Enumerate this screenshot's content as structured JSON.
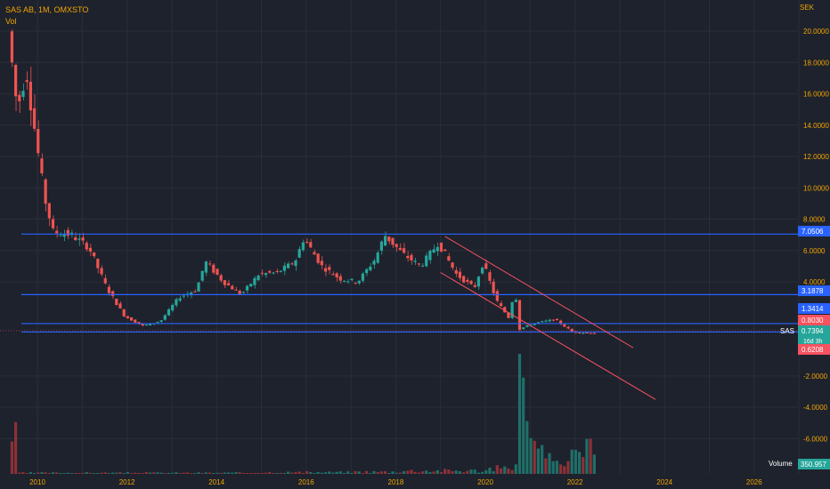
{
  "legend": {
    "symbol": "SAS AB, 1M, OMXSTO",
    "indicator": "Vol"
  },
  "axis": {
    "currency": "SEK",
    "price_ticks": [
      "20.0000",
      "18.0000",
      "16.0000",
      "14.0000",
      "12.0000",
      "10.0000",
      "8.0000",
      "6.0000",
      "4.0000",
      "-2.0000",
      "-4.0000",
      "-6.0000"
    ],
    "price_values": [
      20,
      18,
      16,
      14,
      12,
      10,
      8,
      6,
      4,
      -2,
      -4,
      -6
    ],
    "time_ticks": [
      "2010",
      "2012",
      "2014",
      "2016",
      "2018",
      "2020",
      "2022",
      "2024",
      "2026"
    ],
    "time_values": [
      2010,
      2012,
      2014,
      2016,
      2018,
      2020,
      2022,
      2024,
      2026
    ]
  },
  "levels": [
    {
      "label": "7.0506",
      "value": 7.0506,
      "color": "#2962ff"
    },
    {
      "label": "3.1878",
      "value": 3.1878,
      "color": "#2962ff"
    },
    {
      "label": "1.3414",
      "value": 1.3414,
      "color": "#2962ff"
    },
    {
      "label": "0.8030",
      "value": 0.803,
      "color": "#f23645"
    }
  ],
  "badges": {
    "symbol_label": "SAS",
    "last_price": "0.7394",
    "countdown": "16d 3h",
    "low_price": "0.6208",
    "volume_label": "Volume",
    "volume_value": "350.957"
  },
  "colors": {
    "up": "#26a69a",
    "down": "#ef5350",
    "line": "#2962ff",
    "channel": "#f7525f",
    "bg": "#1e222d",
    "axis_text": "#f0a500"
  },
  "chart_data": {
    "type": "candlestick",
    "title": "SAS AB, 1M, OMXSTO",
    "ylabel": "SEK",
    "ylim": [
      -6.5,
      21
    ],
    "xlim": [
      2009.3,
      2027.6
    ],
    "grid": true,
    "horizontal_levels": [
      7.0506,
      3.1878,
      1.3414,
      0.803
    ],
    "channel": {
      "upper": {
        "from": [
          2019.1,
          6.9
        ],
        "to": [
          2023.3,
          -0.2
        ]
      },
      "lower": {
        "from": [
          2019.0,
          4.6
        ],
        "to": [
          2023.8,
          -3.5
        ]
      }
    },
    "price_path": [
      [
        2009.4,
        20.0
      ],
      [
        2009.6,
        15.0
      ],
      [
        2009.8,
        17.5
      ],
      [
        2010.0,
        13.5
      ],
      [
        2010.2,
        9.5
      ],
      [
        2010.4,
        7.2
      ],
      [
        2010.8,
        7.0
      ],
      [
        2011.2,
        6.2
      ],
      [
        2011.6,
        3.6
      ],
      [
        2012.0,
        1.8
      ],
      [
        2012.4,
        1.2
      ],
      [
        2012.8,
        1.5
      ],
      [
        2013.2,
        3.0
      ],
      [
        2013.6,
        3.5
      ],
      [
        2013.8,
        5.3
      ],
      [
        2014.2,
        4.0
      ],
      [
        2014.6,
        3.2
      ],
      [
        2015.0,
        4.5
      ],
      [
        2015.4,
        4.6
      ],
      [
        2015.8,
        5.3
      ],
      [
        2016.0,
        6.8
      ],
      [
        2016.4,
        5.0
      ],
      [
        2016.8,
        4.2
      ],
      [
        2017.2,
        4.0
      ],
      [
        2017.6,
        5.5
      ],
      [
        2017.8,
        7.0
      ],
      [
        2018.2,
        5.8
      ],
      [
        2018.6,
        5.0
      ],
      [
        2019.0,
        6.5
      ],
      [
        2019.4,
        4.5
      ],
      [
        2019.8,
        3.6
      ],
      [
        2020.0,
        5.2
      ],
      [
        2020.3,
        2.8
      ],
      [
        2020.6,
        1.6
      ],
      [
        2020.7,
        3.9
      ],
      [
        2020.8,
        1.0
      ],
      [
        2021.2,
        1.4
      ],
      [
        2021.6,
        1.6
      ],
      [
        2022.0,
        0.8
      ],
      [
        2022.4,
        0.74
      ]
    ],
    "volume": [
      [
        2009.5,
        0.01
      ],
      [
        2011.0,
        0.01
      ],
      [
        2013.0,
        0.01
      ],
      [
        2015.0,
        0.015
      ],
      [
        2017.0,
        0.02
      ],
      [
        2018.0,
        0.03
      ],
      [
        2019.0,
        0.03
      ],
      [
        2020.0,
        0.05
      ],
      [
        2020.4,
        0.08
      ],
      [
        2020.7,
        1.0
      ],
      [
        2020.9,
        0.45
      ],
      [
        2021.3,
        0.15
      ],
      [
        2021.8,
        0.15
      ],
      [
        2022.1,
        0.3
      ],
      [
        2022.5,
        0.45
      ]
    ]
  }
}
